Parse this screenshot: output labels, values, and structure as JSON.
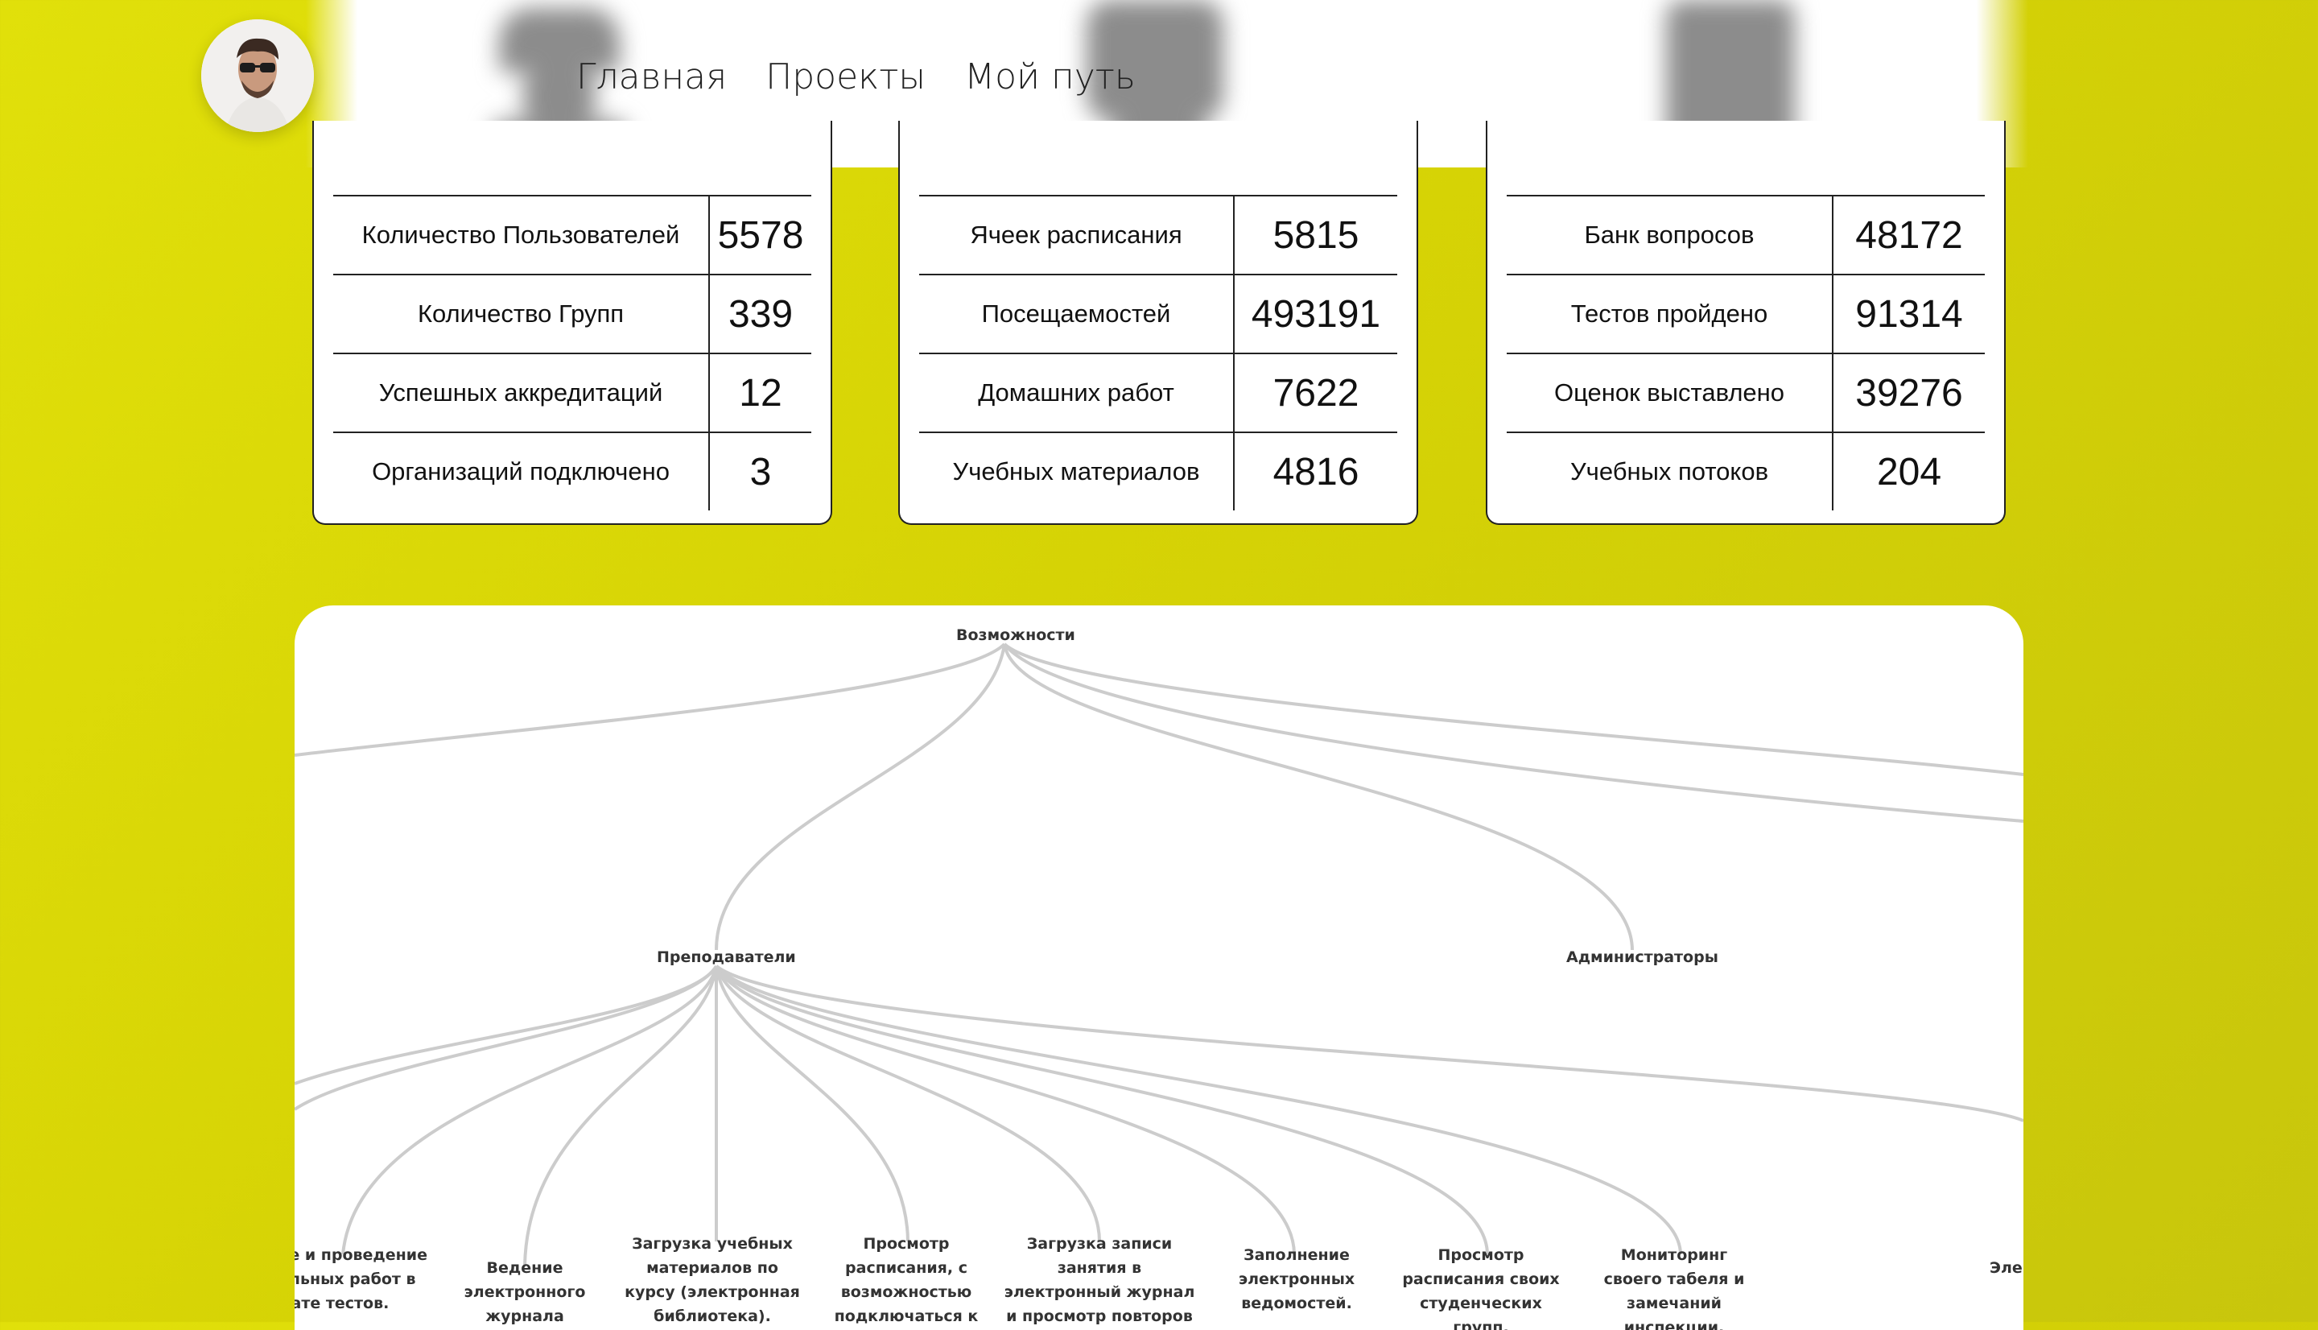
{
  "nav": {
    "home": "Главная",
    "projects": "Проекты",
    "path": "Мой путь"
  },
  "cards": [
    {
      "rows": [
        {
          "label": "Количество Пользователей",
          "value": "5578"
        },
        {
          "label": "Количество Групп",
          "value": "339"
        },
        {
          "label": "Успешных аккредитаций",
          "value": "12"
        },
        {
          "label": "Организаций подключено",
          "value": "3"
        }
      ]
    },
    {
      "rows": [
        {
          "label": "Ячеек расписания",
          "value": "5815"
        },
        {
          "label": "Посещаемостей",
          "value": "493191"
        },
        {
          "label": "Домашних работ",
          "value": "7622"
        },
        {
          "label": "Учебных материалов",
          "value": "4816"
        }
      ]
    },
    {
      "rows": [
        {
          "label": "Банк вопросов",
          "value": "48172"
        },
        {
          "label": "Тестов пройдено",
          "value": "91314"
        },
        {
          "label": "Оценок выставлено",
          "value": "39276"
        },
        {
          "label": "Учебных потоков",
          "value": "204"
        }
      ]
    }
  ],
  "tree": {
    "root": "Возможности",
    "teachers": "Преподаватели",
    "admins": "Администраторы",
    "leaves": [
      "ие и проведение ольных работ в мате тестов.",
      "Ведение электронного журнала посещаемости.",
      "Загрузка учебных материалов по курсу (электронная библиотека).",
      "Просмотр расписания, с возможностью подключаться к своей комнате.",
      "Загрузка записи занятия в электронный журнал и просмотр повторов занятий.",
      "Заполнение электронных ведомостей.",
      "Просмотр расписания своих студенческих групп.",
      "Мониторинг своего табеля и замечаний инспекции.",
      "Элек"
    ]
  },
  "colors": {
    "accent": "#d9d707",
    "edge": "#cccccc"
  }
}
